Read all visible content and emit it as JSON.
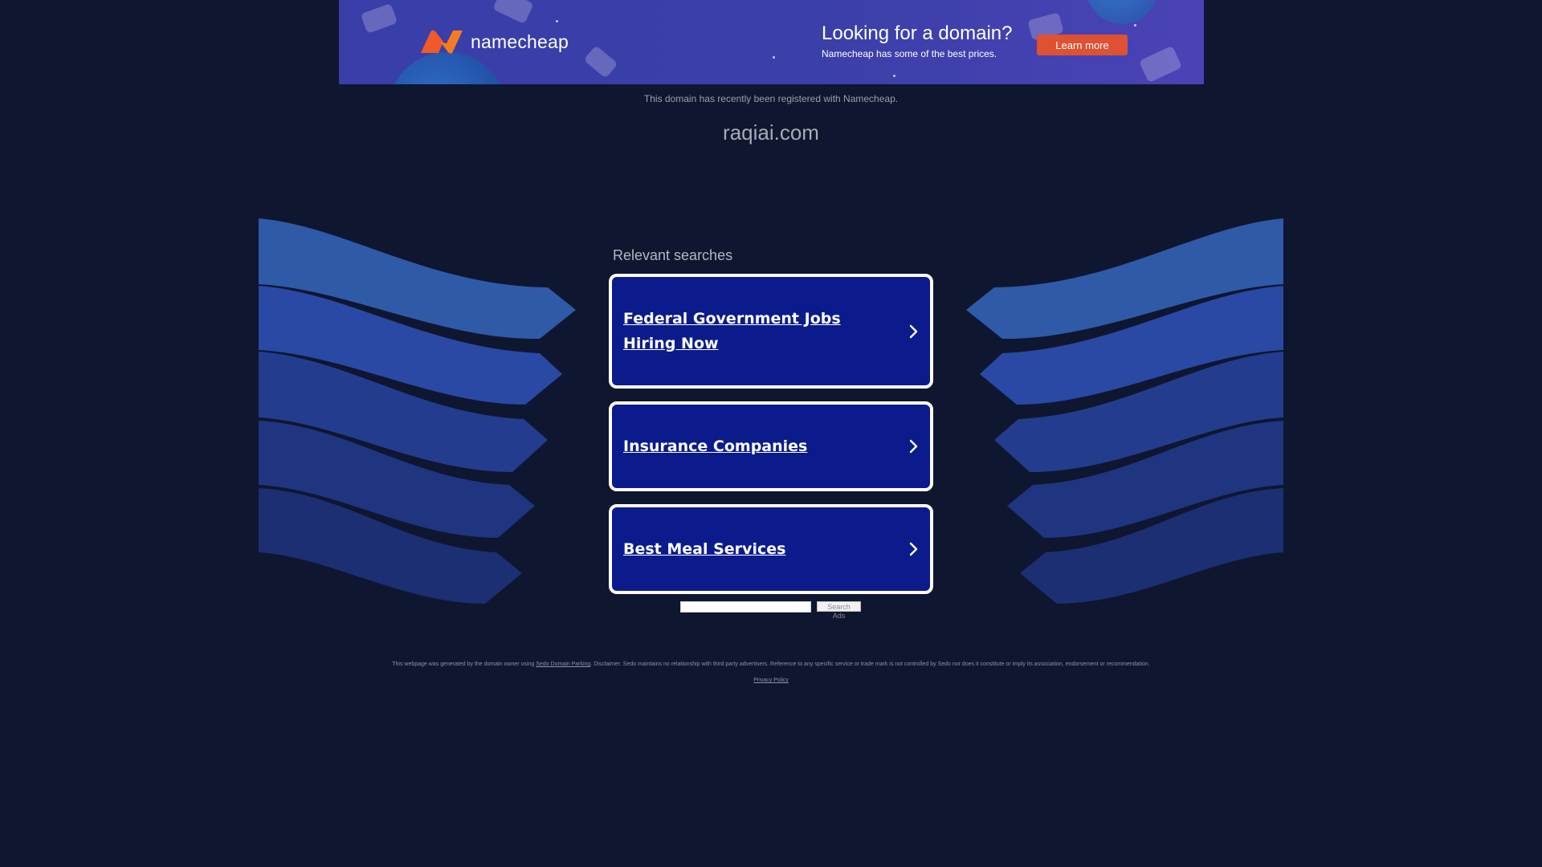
{
  "banner": {
    "logo_text": "namecheap",
    "title": "Looking for a domain?",
    "subtitle": "Namecheap has some of the best prices.",
    "cta_label": "Learn more",
    "colors": {
      "background": "#3b3fa8",
      "cta": "#de5133",
      "logo_mark": "#f05a28"
    }
  },
  "header": {
    "registered_note": "This domain has recently been registered with Namecheap.",
    "domain_name": "raqiai.com"
  },
  "relevant_searches": {
    "heading": "Relevant searches",
    "items": [
      {
        "label": "Federal Government Jobs Hiring Now"
      },
      {
        "label": "Insurance Companies"
      },
      {
        "label": "Best Meal Services"
      }
    ],
    "colors": {
      "card": "#0b1b8c",
      "border": "#ffffff"
    }
  },
  "search_ads": {
    "button_label": "Search Ads",
    "input_value": ""
  },
  "footer": {
    "text_before_link": "This webpage was generated by the domain owner using ",
    "link_text": "Sedo Domain Parking",
    "text_after_link": ". Disclaimer: Sedo maintains no relationship with third party advertisers. Reference to any specific service or trade mark is not controlled by Sedo nor does it constitute or imply its association, endorsement or recommendation.",
    "privacy_label": "Privacy Policy"
  },
  "icons": {
    "logo": "namecheap-logo-icon",
    "chevron": "chevron-right-icon"
  },
  "page_colors": {
    "background": "#0f1630"
  }
}
